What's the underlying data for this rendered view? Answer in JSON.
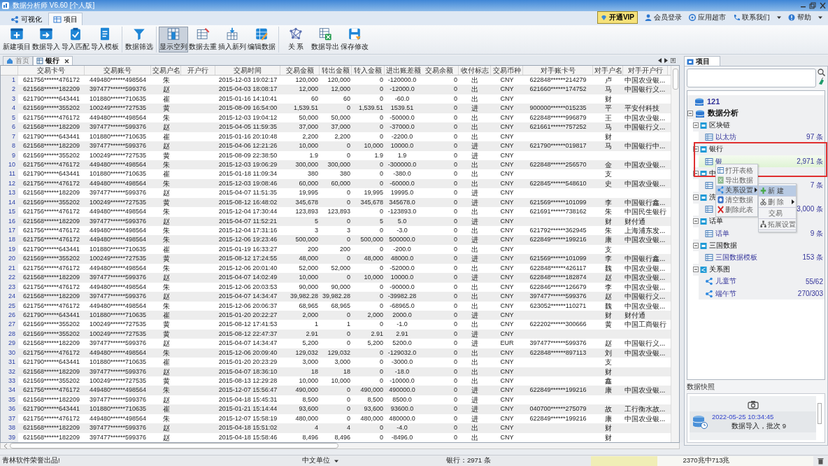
{
  "window": {
    "title": "数据分析师 V6.60 [个人版]"
  },
  "ribbon_tabs": [
    {
      "label": "可视化",
      "selected": false
    },
    {
      "label": "项目",
      "selected": true
    }
  ],
  "header_links": {
    "vip": "开通VIP",
    "items": [
      {
        "label": "会员登录",
        "dropdown": false
      },
      {
        "label": "应用超市",
        "dropdown": false
      },
      {
        "label": "联系我们",
        "dropdown": true
      },
      {
        "label": "帮助",
        "dropdown": true
      }
    ]
  },
  "toolbar_groups": [
    [
      {
        "label": "新建项目",
        "pressed": false
      },
      {
        "label": "数据导入",
        "pressed": false
      },
      {
        "label": "导入匹配",
        "pressed": false
      },
      {
        "label": "导入模板",
        "pressed": false
      }
    ],
    [
      {
        "label": "数据筛选",
        "pressed": false
      }
    ],
    [
      {
        "label": "显示空列",
        "pressed": true
      },
      {
        "label": "数据去重",
        "pressed": false
      },
      {
        "label": "插入新列",
        "pressed": false
      },
      {
        "label": "编辑数据",
        "pressed": false
      }
    ],
    [
      {
        "label": "关 系",
        "pressed": false
      },
      {
        "label": "数据导出",
        "pressed": false
      },
      {
        "label": "保存修改",
        "pressed": false
      }
    ]
  ],
  "doc_tabs": [
    {
      "label": "首页",
      "selected": false,
      "closable": false
    },
    {
      "label": "银行",
      "selected": true,
      "closable": true
    }
  ],
  "table": {
    "columns": [
      "交易卡号",
      "交易账号",
      "交易户名",
      "开户行",
      "交易时间",
      "交易金额",
      "转出金额",
      "转入金额",
      "进出账差额",
      "交易余额",
      "收付标志",
      "交易币种",
      "对手账卡号",
      "对手户名",
      "对手开户行"
    ],
    "rows": [
      {
        "number": "1",
        "cells": [
          "621756******476172",
          "449480******498564",
          "朱",
          null,
          "2015-12-03 19:02:17",
          "120,000",
          "120,000",
          "0",
          "-120000.0",
          "0",
          "出",
          "CNY",
          "622848******214279",
          "卢",
          "中国农业银..."
        ]
      },
      {
        "number": "2",
        "cells": [
          "621568******182209",
          "397477******599376",
          "赵",
          null,
          "2015-04-03 18:08:17",
          "12,000",
          "12,000",
          "0",
          "-12000.0",
          "0",
          "出",
          "CNY",
          "621660******174752",
          "马",
          "中国银行义..."
        ]
      },
      {
        "number": "3",
        "cells": [
          "621790******643441",
          "101880******710635",
          "崔",
          null,
          "2015-01-16 14:10:41",
          "60",
          "60",
          "0",
          "-60.0",
          "0",
          "出",
          "CNY",
          null,
          "财",
          null
        ]
      },
      {
        "number": "4",
        "cells": [
          "621569******355202",
          "100249******727535",
          "黄",
          null,
          "2015-08-09 16:54:00",
          "1,539.51",
          "0",
          "1,539.51",
          "1539.51",
          "0",
          "进",
          "CNY",
          "900000******015235",
          "平",
          "平安付科技"
        ]
      },
      {
        "number": "5",
        "cells": [
          "621756******476172",
          "449480******498564",
          "朱",
          null,
          "2015-12-03 19:04:12",
          "50,000",
          "50,000",
          "0",
          "-50000.0",
          "0",
          "出",
          "CNY",
          "622848******996879",
          "王",
          "中国农业银..."
        ]
      },
      {
        "number": "6",
        "cells": [
          "621568******182209",
          "397477******599376",
          "赵",
          null,
          "2015-04-05 11:59:35",
          "37,000",
          "37,000",
          "0",
          "-37000.0",
          "0",
          "出",
          "CNY",
          "621661******757252",
          "马",
          "中国银行义..."
        ]
      },
      {
        "number": "7",
        "cells": [
          "621790******643441",
          "101880******710635",
          "崔",
          null,
          "2015-01-16 20:10:48",
          "2,200",
          "2,200",
          "0",
          "-2200.0",
          "0",
          "出",
          "CNY",
          null,
          "财",
          null
        ]
      },
      {
        "number": "8",
        "cells": [
          "621568******182209",
          "397477******599376",
          "赵",
          null,
          "2015-04-06 12:21:26",
          "10,000",
          "0",
          "10,000",
          "10000.0",
          "0",
          "进",
          "CNY",
          "621790******019817",
          "马",
          "中国银行中..."
        ]
      },
      {
        "number": "9",
        "cells": [
          "621569******355202",
          "100249******727535",
          "黄",
          null,
          "2015-08-09 22:38:50",
          "1.9",
          "0",
          "1.9",
          "1.9",
          "0",
          "进",
          "CNY",
          null,
          null,
          null
        ]
      },
      {
        "number": "10",
        "cells": [
          "621756******476172",
          "449480******498564",
          "朱",
          null,
          "2015-12-03 19:06:29",
          "300,000",
          "300,000",
          "0",
          "-300000.0",
          "0",
          "出",
          "CNY",
          "622848******256570",
          "金",
          "中国农业银..."
        ]
      },
      {
        "number": "11",
        "cells": [
          "621790******643441",
          "101880******710635",
          "崔",
          null,
          "2015-01-18 11:09:34",
          "380",
          "380",
          "0",
          "-380.0",
          "0",
          "出",
          "CNY",
          null,
          "支",
          null
        ]
      },
      {
        "number": "12",
        "cells": [
          "621756******476172",
          "449480******498564",
          "朱",
          null,
          "2015-12-03 19:08:46",
          "60,000",
          "60,000",
          "0",
          "-60000.0",
          "0",
          "出",
          "CNY",
          "622845******548610",
          "史",
          "中国农业银..."
        ]
      },
      {
        "number": "13",
        "cells": [
          "621568******182209",
          "397477******599376",
          "赵",
          null,
          "2015-04-07 11:51:35",
          "19,995",
          "0",
          "19,995",
          "19995.0",
          "0",
          "进",
          "CNY",
          null,
          null,
          null
        ]
      },
      {
        "number": "14",
        "cells": [
          "621569******355202",
          "100249******727535",
          "黄",
          null,
          "2015-08-12 16:48:02",
          "345,678",
          "0",
          "345,678",
          "345678.0",
          "0",
          "进",
          "CNY",
          "621569******101099",
          "李",
          "中国银行鑫..."
        ]
      },
      {
        "number": "15",
        "cells": [
          "621756******476172",
          "449480******498564",
          "朱",
          null,
          "2015-12-04 17:30:44",
          "123,893",
          "123,893",
          "0",
          "-123893.0",
          "0",
          "出",
          "CNY",
          "621691******738162",
          "朱",
          "中国民生银行"
        ]
      },
      {
        "number": "16",
        "cells": [
          "621568******182209",
          "397477******599376",
          "赵",
          null,
          "2015-04-07 11:52:21",
          "5",
          "0",
          "5",
          "5.0",
          "0",
          "进",
          "CNY",
          null,
          "财",
          "财付通"
        ]
      },
      {
        "number": "17",
        "cells": [
          "621756******476172",
          "449480******498564",
          "朱",
          null,
          "2015-12-04 17:31:16",
          "3",
          "3",
          "0",
          "-3.0",
          "0",
          "出",
          "CNY",
          "621792******362945",
          "朱",
          "上海浦东发..."
        ]
      },
      {
        "number": "18",
        "cells": [
          "621756******476172",
          "449480******498564",
          "朱",
          null,
          "2015-12-06 19:23:46",
          "500,000",
          "0",
          "500,000",
          "500000.0",
          "0",
          "进",
          "CNY",
          "622849******199216",
          "康",
          "中国农业银..."
        ]
      },
      {
        "number": "19",
        "cells": [
          "621790******643441",
          "101880******710635",
          "崔",
          null,
          "2015-01-19 16:33:27",
          "200",
          "200",
          "0",
          "-200.0",
          "0",
          "出",
          "CNY",
          null,
          "支",
          null
        ]
      },
      {
        "number": "20",
        "cells": [
          "621569******355202",
          "100249******727535",
          "黄",
          null,
          "2015-08-12 17:24:55",
          "48,000",
          "0",
          "48,000",
          "48000.0",
          "0",
          "进",
          "CNY",
          "621569******101099",
          "李",
          "中国银行鑫..."
        ]
      },
      {
        "number": "21",
        "cells": [
          "621756******476172",
          "449480******498564",
          "朱",
          null,
          "2015-12-06 20:01:40",
          "52,000",
          "52,000",
          "0",
          "-52000.0",
          "0",
          "出",
          "CNY",
          "622848******426117",
          "魏",
          "中国农业银..."
        ]
      },
      {
        "number": "22",
        "cells": [
          "621568******182209",
          "397477******599376",
          "赵",
          null,
          "2015-04-07 14:02:49",
          "10,000",
          "0",
          "10,000",
          "10000.0",
          "0",
          "进",
          "CNY",
          "622848******182874",
          "赵",
          "中国农业银..."
        ]
      },
      {
        "number": "23",
        "cells": [
          "621756******476172",
          "449480******498564",
          "朱",
          null,
          "2015-12-06 20:03:53",
          "90,000",
          "90,000",
          "0",
          "-90000.0",
          "0",
          "出",
          "CNY",
          "622846******126679",
          "李",
          "中国农业银..."
        ]
      },
      {
        "number": "24",
        "cells": [
          "621568******182209",
          "397477******599376",
          "赵",
          null,
          "2015-04-07 14:34:47",
          "39,982.28",
          "39,982.28",
          "0",
          "-39982.28",
          "0",
          "出",
          "CNY",
          "397477******599376",
          "赵",
          "中国银行义..."
        ]
      },
      {
        "number": "25",
        "cells": [
          "621756******476172",
          "449480******498564",
          "朱",
          null,
          "2015-12-06 20:06:37",
          "68,965",
          "68,965",
          "0",
          "-68965.0",
          "0",
          "出",
          "CNY",
          "623052******110271",
          "魏",
          "中国农业银..."
        ]
      },
      {
        "number": "26",
        "cells": [
          "621790******643441",
          "101880******710635",
          "崔",
          null,
          "2015-01-20 20:22:27",
          "2,000",
          "0",
          "2,000",
          "2000.0",
          "0",
          "进",
          "CNY",
          null,
          "财",
          "财付通"
        ]
      },
      {
        "number": "27",
        "cells": [
          "621569******355202",
          "100249******727535",
          "黄",
          null,
          "2015-08-12 17:41:53",
          "1",
          "1",
          "0",
          "-1.0",
          "0",
          "出",
          "CNY",
          "622202******300666",
          "黄",
          "中国工商银行"
        ]
      },
      {
        "number": "28",
        "cells": [
          "621569******355202",
          "100249******727535",
          "黄",
          null,
          "2015-08-12 22:47:37",
          "2.91",
          "0",
          "2.91",
          "2.91",
          "0",
          "进",
          "CNY",
          null,
          null,
          null
        ]
      },
      {
        "number": "29",
        "cells": [
          "621568******182209",
          "397477******599376",
          "赵",
          null,
          "2015-04-07 14:34:47",
          "5,200",
          "0",
          "5,200",
          "5200.0",
          "0",
          "进",
          "EUR",
          "397477******599376",
          "赵",
          "中国银行义..."
        ]
      },
      {
        "number": "30",
        "cells": [
          "621756******476172",
          "449480******498564",
          "朱",
          null,
          "2015-12-06 20:09:40",
          "129,032",
          "129,032",
          "0",
          "-129032.0",
          "0",
          "出",
          "CNY",
          "622848******897113",
          "刘",
          "中国农业银..."
        ]
      },
      {
        "number": "31",
        "cells": [
          "621790******643441",
          "101880******710635",
          "崔",
          null,
          "2015-01-20 20:23:29",
          "3,000",
          "3,000",
          "0",
          "-3000.0",
          "0",
          "出",
          "CNY",
          null,
          "支",
          null
        ]
      },
      {
        "number": "32",
        "cells": [
          "621568******182209",
          "397477******599376",
          "赵",
          null,
          "2015-04-07 18:36:10",
          "18",
          "18",
          "0",
          "-18.0",
          "0",
          "出",
          "CNY",
          null,
          "财",
          null
        ]
      },
      {
        "number": "33",
        "cells": [
          "621569******355202",
          "100249******727535",
          "黄",
          null,
          "2015-08-13 12:29:28",
          "10,000",
          "10,000",
          "0",
          "-10000.0",
          "0",
          "出",
          "CNY",
          null,
          "鑫",
          null
        ]
      },
      {
        "number": "34",
        "cells": [
          "621756******476172",
          "449480******498564",
          "朱",
          null,
          "2015-12-07 15:56:47",
          "490,000",
          "0",
          "490,000",
          "490000.0",
          "0",
          "进",
          "CNY",
          "622849******199216",
          "康",
          "中国农业银..."
        ]
      },
      {
        "number": "35",
        "cells": [
          "621568******182209",
          "397477******599376",
          "赵",
          null,
          "2015-04-18 15:45:31",
          "8,500",
          "0",
          "8,500",
          "8500.0",
          "0",
          "进",
          "CNY",
          null,
          null,
          null
        ]
      },
      {
        "number": "36",
        "cells": [
          "621790******643441",
          "101880******710635",
          "崔",
          null,
          "2015-01-21 15:14:44",
          "93,600",
          "0",
          "93,600",
          "93600.0",
          "0",
          "进",
          "CNY",
          "040700******275079",
          "故",
          "工行衡水故..."
        ]
      },
      {
        "number": "37",
        "cells": [
          "621756******476172",
          "449480******498564",
          "朱",
          null,
          "2015-12-07 15:58:19",
          "480,000",
          "0",
          "480,000",
          "480000.0",
          "0",
          "进",
          "CNY",
          "622849******199216",
          "康",
          "中国农业银..."
        ]
      },
      {
        "number": "38",
        "cells": [
          "621568******182209",
          "397477******599376",
          "赵",
          null,
          "2015-04-18 15:51:02",
          "4",
          "4",
          "0",
          "-4.0",
          "0",
          "出",
          "CNY",
          null,
          "财",
          null
        ]
      },
      {
        "number": "39",
        "cells": [
          "621568******182209",
          "397477******599376",
          "赵",
          null,
          "2015-04-18 15:58:46",
          "8,496",
          "8,496",
          "0",
          "-8496.0",
          "0",
          "出",
          "CNY",
          null,
          "财",
          null
        ]
      }
    ]
  },
  "side_panel": {
    "tab": "项目",
    "tree": [
      {
        "label": "121",
        "kind": "database",
        "selected": false
      },
      {
        "label": "数据分析",
        "kind": "database",
        "expanded": true,
        "selected": false,
        "children": [
          {
            "label": "区块链",
            "kind": "folder",
            "expanded": true,
            "selected": false,
            "children": [
              {
                "label": "以太坊",
                "kind": "table",
                "count": "97 条",
                "selected": false
              }
            ]
          },
          {
            "label": "银行",
            "kind": "folder",
            "expanded": true,
            "selected": false,
            "children": [
              {
                "label": "银",
                "kind": "table",
                "count": "2,971 条",
                "selected": true
              }
            ]
          },
          {
            "label": "中",
            "kind": "folder",
            "expanded": true,
            "selected": false,
            "children": [
              {
                "kind": "table",
                "count": "7 条",
                "selected": false
              }
            ]
          },
          {
            "label": "洗",
            "kind": "folder",
            "expanded": true,
            "selected": false,
            "children": [
              {
                "kind": "table",
                "count": "3,000 条",
                "selected": false
              }
            ]
          },
          {
            "label": "话单",
            "kind": "folder",
            "expanded": true,
            "selected": false,
            "children": [
              {
                "label": "话单",
                "kind": "table",
                "count": "9 条",
                "selected": false
              }
            ]
          },
          {
            "label": "三国数据",
            "kind": "folder",
            "expanded": true,
            "selected": false,
            "children": [
              {
                "label": "三国数据模板",
                "kind": "table",
                "count": "153 条",
                "selected": false
              }
            ]
          },
          {
            "label": "关系图",
            "kind": "graph-folder",
            "expanded": true,
            "selected": false,
            "children": [
              {
                "label": "儿童节",
                "kind": "graph",
                "count": "55/62",
                "selected": false
              },
              {
                "label": "端午节",
                "kind": "graph",
                "count": "270/303",
                "selected": false
              }
            ]
          }
        ]
      }
    ],
    "context_menu": [
      {
        "label": "打开表格",
        "selected": false,
        "submenu": false
      },
      {
        "label": "导出数据",
        "selected": false,
        "submenu": false
      },
      {
        "label": "关系设置",
        "selected": true,
        "submenu": true
      },
      {
        "label": "清空数据",
        "selected": false,
        "submenu": false
      },
      {
        "label": "删除此表",
        "selected": false,
        "submenu": false
      }
    ],
    "submenu": [
      {
        "label": "新 建",
        "selected": true,
        "submenu": false
      },
      {
        "label": "删 除",
        "selected": false,
        "submenu": true
      },
      {
        "label": "交易",
        "selected": false,
        "submenu": false
      },
      {
        "label": "拓展设置",
        "selected": false,
        "submenu": false
      }
    ],
    "snapshot": {
      "title": "数据快照",
      "entries": [
        {
          "time": "2022-05-25 10:34:45",
          "description": "数据导入，批次 9"
        }
      ]
    }
  },
  "status_bar": {
    "credit": "青林软件荣誉出品!",
    "unit": "中文单位",
    "record_count": "银行：2971 条",
    "memory": {
      "level": 0.3,
      "text": "2370兆中713兆"
    }
  }
}
